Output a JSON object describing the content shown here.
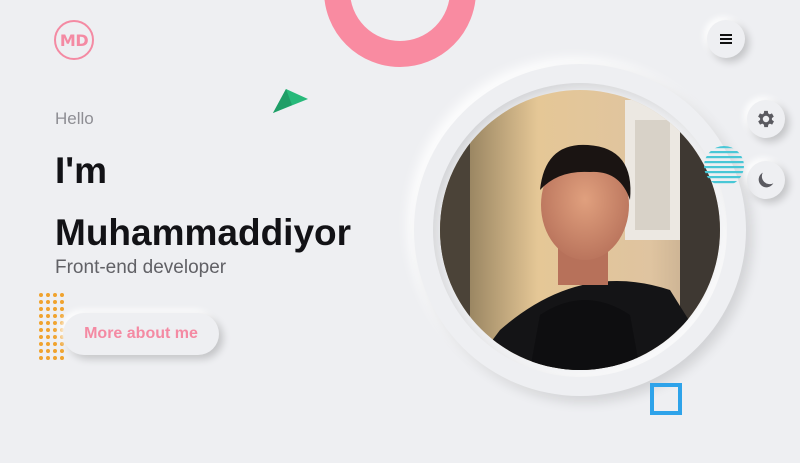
{
  "header": {
    "logo_text": "MD",
    "menu_icon": "hamburger-icon"
  },
  "controls": {
    "settings_icon": "gear-icon",
    "theme_icon": "moon-icon"
  },
  "hero": {
    "greeting": "Hello",
    "title_line1": "I'm",
    "title_line2": "Muhammaddiyor",
    "subtitle": "Front-end developer",
    "cta_label": "More about me"
  },
  "colors": {
    "accent_pink": "#f48aa3",
    "background": "#eeeff2",
    "triangle_green": "#27b97a",
    "square_blue": "#2ea3ea",
    "dots_orange": "#f0a32e",
    "stripes_teal": "#49c7d6"
  }
}
